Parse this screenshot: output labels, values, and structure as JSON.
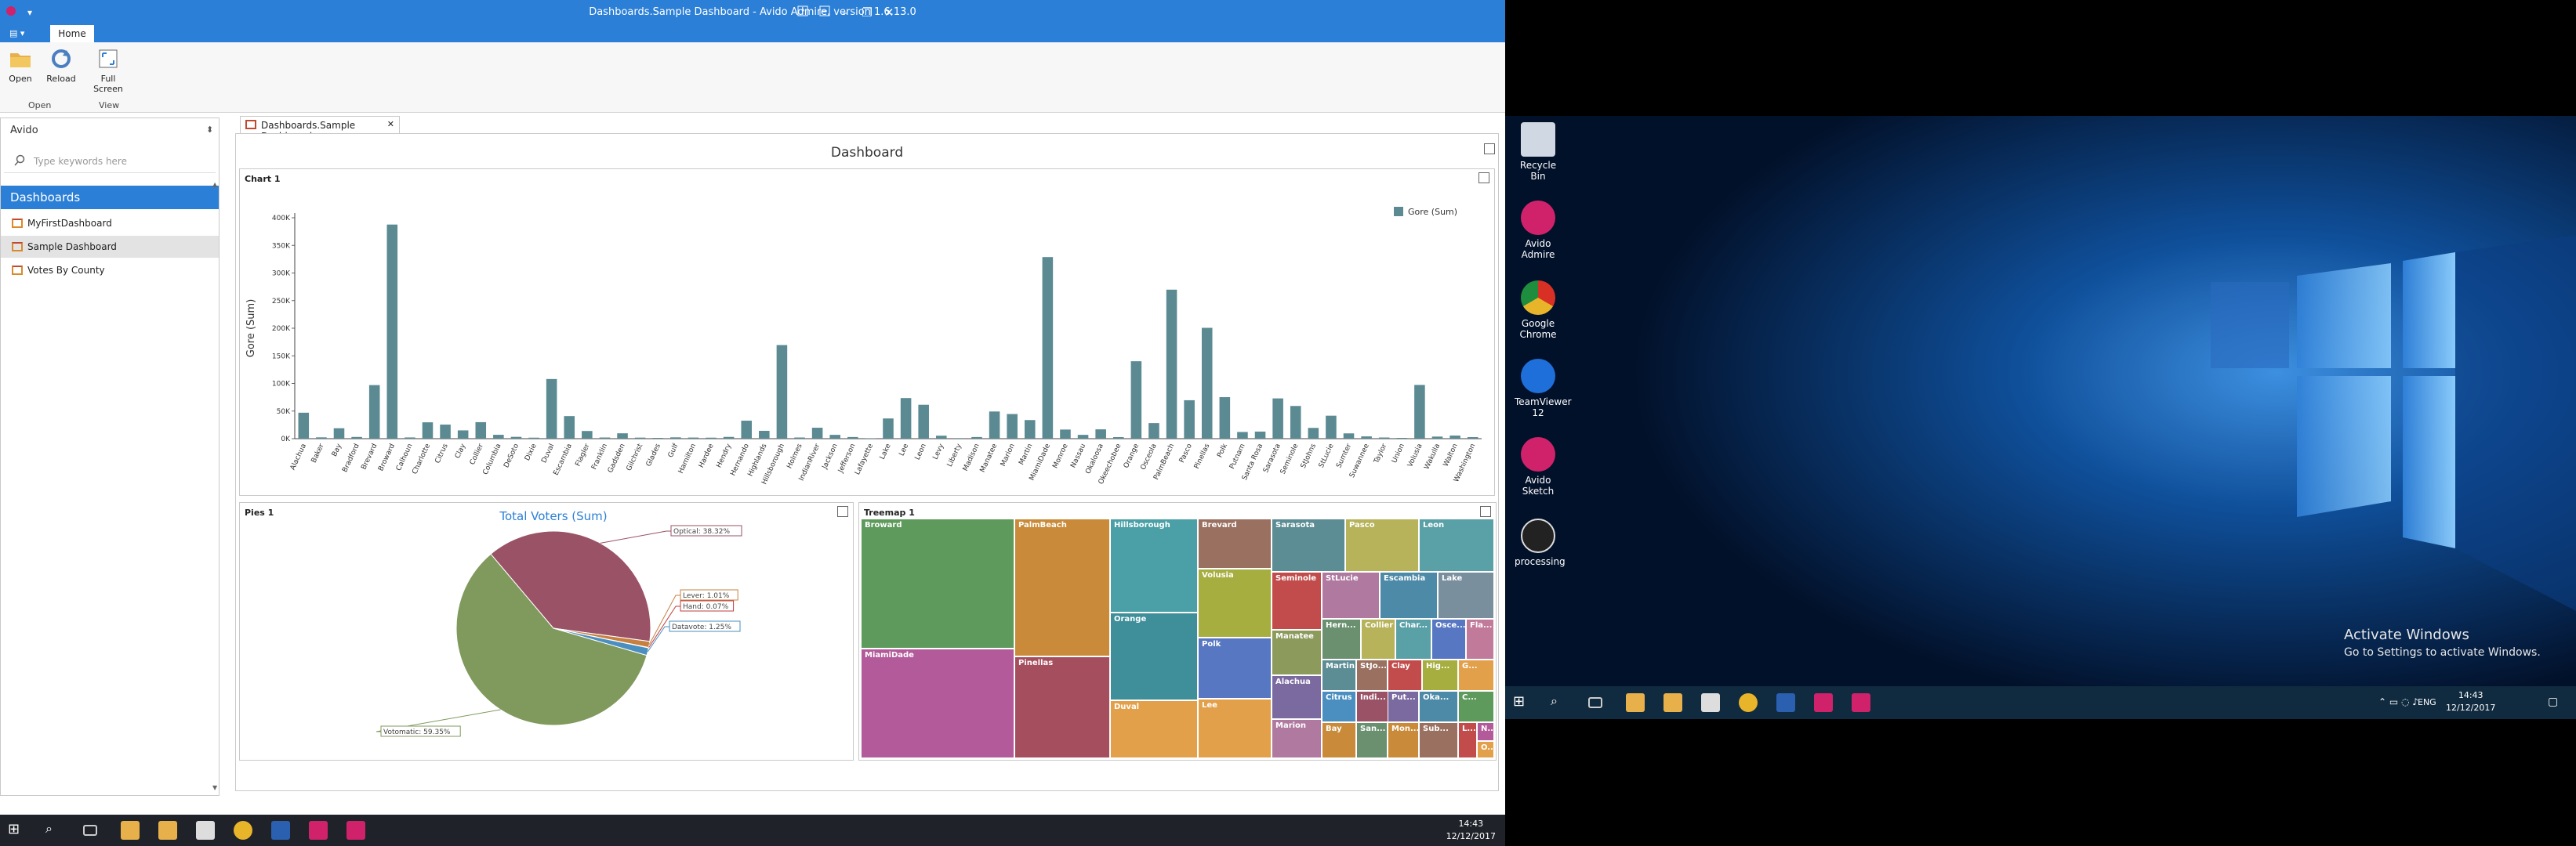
{
  "app": {
    "title": "Dashboards.Sample Dashboard - Avido Admire, version 1.6.13.0",
    "tabs": [
      "Home"
    ],
    "ribbon": {
      "open_label": "Open",
      "reload_label": "Reload",
      "fullscreen_label": "Full Screen",
      "group_open": "Open",
      "group_view": "View"
    }
  },
  "left_panel": {
    "title": "Avido",
    "search_placeholder": "Type keywords here",
    "section": "Dashboards",
    "items": [
      "MyFirstDashboard",
      "Sample Dashboard",
      "Votes By County"
    ]
  },
  "document": {
    "tab_label": "Dashboards.Sample Dashboard",
    "dashboard_title": "Dashboard",
    "chart_panel_title": "Chart 1",
    "pies_panel_title": "Pies 1",
    "treemap_panel_title": "Treemap 1"
  },
  "chart_data": [
    {
      "type": "bar",
      "title": "",
      "ylabel": "Gore (Sum)",
      "legend": "Gore (Sum)",
      "legend_position": "top-right",
      "ylim": [
        0,
        400000
      ],
      "yticks": [
        "0K",
        "50K",
        "100K",
        "150K",
        "200K",
        "250K",
        "300K",
        "350K",
        "400K"
      ],
      "color": "#5b8a93",
      "categories": [
        "Alachua",
        "Baker",
        "Bay",
        "Bradford",
        "Brevard",
        "Broward",
        "Calhoun",
        "Charlotte",
        "Citrus",
        "Clay",
        "Collier",
        "Columbia",
        "DeSoto",
        "Dixie",
        "Duval",
        "Escambia",
        "Flagler",
        "Franklin",
        "Gadsden",
        "Gilchrist",
        "Glades",
        "Gulf",
        "Hamilton",
        "Hardee",
        "Hendry",
        "Hernando",
        "Highlands",
        "Hillsborough",
        "Holmes",
        "IndianRiver",
        "Jackson",
        "Jefferson",
        "Lafayette",
        "Lake",
        "Lee",
        "Leon",
        "Levy",
        "Liberty",
        "Madison",
        "Manatee",
        "Marion",
        "Martin",
        "MiamiDade",
        "Monroe",
        "Nassau",
        "Okaloosa",
        "Okeechobee",
        "Orange",
        "Osceola",
        "PalmBeach",
        "Pasco",
        "Pinellas",
        "Polk",
        "Putnam",
        "Santa Rosa",
        "Sarasota",
        "Seminole",
        "StJohns",
        "StLucie",
        "Sumter",
        "Suwannee",
        "Taylor",
        "Union",
        "Volusia",
        "Wakulla",
        "Walton",
        "Washington"
      ],
      "values": [
        47000,
        2400,
        18900,
        3100,
        97000,
        387700,
        2200,
        29600,
        25500,
        15000,
        29900,
        7000,
        3300,
        1800,
        108000,
        40900,
        13900,
        2100,
        9700,
        1900,
        1400,
        2400,
        2000,
        1800,
        3200,
        32600,
        14200,
        169500,
        2100,
        19800,
        6900,
        3000,
        800,
        36600,
        73500,
        61400,
        5400,
        1000,
        3000,
        49200,
        44600,
        33700,
        328800,
        16500,
        6900,
        16900,
        2800,
        140200,
        28200,
        269800,
        69600,
        200700,
        75200,
        12100,
        12800,
        72900,
        59200,
        19500,
        41600,
        9600,
        4100,
        2100,
        1400,
        97300,
        3800,
        5600,
        2800
      ]
    },
    {
      "type": "pie",
      "title": "Total Voters (Sum)",
      "slices": [
        {
          "label": "Votomatic",
          "value": 59.35,
          "text": "Votomatic: 59.35%",
          "color": "#7f9a5c"
        },
        {
          "label": "Optical",
          "value": 38.32,
          "text": "Optical: 38.32%",
          "color": "#9a5266"
        },
        {
          "label": "Lever",
          "value": 1.01,
          "text": "Lever: 1.01%",
          "color": "#c78040"
        },
        {
          "label": "Hand",
          "value": 0.07,
          "text": "Hand: 0.07%",
          "color": "#c23b3b"
        },
        {
          "label": "Datavote",
          "value": 1.25,
          "text": "Datavote: 1.25%",
          "color": "#4a8fc0"
        }
      ]
    },
    {
      "type": "treemap",
      "tiles": [
        {
          "label": "Broward",
          "color": "#5e9a5c"
        },
        {
          "label": "MiamiDade",
          "color": "#b35a9a"
        },
        {
          "label": "PalmBeach",
          "color": "#c98b39"
        },
        {
          "label": "Pinellas",
          "color": "#a54e5e"
        },
        {
          "label": "Hillsborough",
          "color": "#4aa0a6"
        },
        {
          "label": "Orange",
          "color": "#3f8f9b"
        },
        {
          "label": "Duval",
          "color": "#e3a04a"
        },
        {
          "label": "Brevard",
          "color": "#9a7060"
        },
        {
          "label": "Volusia",
          "color": "#a7ae40"
        },
        {
          "label": "Polk",
          "color": "#5877c2"
        },
        {
          "label": "Lee",
          "color": "#e3a04a"
        },
        {
          "label": "Sarasota",
          "color": "#5c8c94"
        },
        {
          "label": "Pasco",
          "color": "#b6b35a"
        },
        {
          "label": "Leon",
          "color": "#5aa0a7"
        },
        {
          "label": "Seminole",
          "color": "#c24c4c"
        },
        {
          "label": "StLucie",
          "color": "#b07aa0"
        },
        {
          "label": "Escambia",
          "color": "#4d8aa8"
        },
        {
          "label": "Lake",
          "color": "#7a8f9e"
        },
        {
          "label": "Manatee",
          "color": "#8c9a5c"
        },
        {
          "label": "Alachua",
          "color": "#7a6aa0"
        },
        {
          "label": "Marion",
          "color": "#b07aa0"
        },
        {
          "label": "Hern...",
          "color": "#6a9070"
        },
        {
          "label": "Collier",
          "color": "#b6b35a"
        },
        {
          "label": "Martin",
          "color": "#5c8c94"
        },
        {
          "label": "StJo...",
          "color": "#9a7060"
        },
        {
          "label": "Citrus",
          "color": "#4a8fc0"
        },
        {
          "label": "Bay",
          "color": "#c98b39"
        },
        {
          "label": "Indi...",
          "color": "#9a5266"
        },
        {
          "label": "Clay",
          "color": "#c24c4c"
        },
        {
          "label": "Char...",
          "color": "#5aa0a7"
        },
        {
          "label": "Osce...",
          "color": "#5877c2"
        },
        {
          "label": "Hig...",
          "color": "#a7ae40"
        },
        {
          "label": "Fla...",
          "color": "#c27a9a"
        },
        {
          "label": "San...",
          "color": "#6a9070"
        },
        {
          "label": "Put...",
          "color": "#7a6aa0"
        },
        {
          "label": "G...",
          "color": "#e3a04a"
        },
        {
          "label": "Oka...",
          "color": "#4d8aa8"
        },
        {
          "label": "Mon...",
          "color": "#c98b39"
        },
        {
          "label": "Sub...",
          "color": "#9a7060"
        },
        {
          "label": "C...",
          "color": "#5e9a5c"
        },
        {
          "label": "L...",
          "color": "#c24c4c"
        },
        {
          "label": "N...",
          "color": "#b35a9a"
        },
        {
          "label": "O...",
          "color": "#e3a04a"
        }
      ]
    }
  ],
  "left_taskbar": {
    "time": "14:43",
    "date": "12/12/2017"
  },
  "desktop": {
    "icons": [
      {
        "label": "Recycle Bin",
        "icon": "recycle-bin-icon",
        "color": "#cfd8e3"
      },
      {
        "label": "Avido Admire",
        "icon": "avido-admire-icon",
        "color": "#d0226a"
      },
      {
        "label": "Google Chrome",
        "icon": "chrome-icon",
        "color": "#e8b42a"
      },
      {
        "label": "TeamViewer 12",
        "icon": "teamviewer-icon",
        "color": "#1e6fd9"
      },
      {
        "label": "Avido Sketch",
        "icon": "avido-sketch-icon",
        "color": "#d0226a"
      },
      {
        "label": "processing",
        "icon": "processing-icon",
        "color": "#222222"
      }
    ],
    "activate_title": "Activate Windows",
    "activate_sub": "Go to Settings to activate Windows.",
    "taskbar": {
      "lang": "ENG",
      "time": "14:43",
      "date": "12/12/2017"
    }
  }
}
